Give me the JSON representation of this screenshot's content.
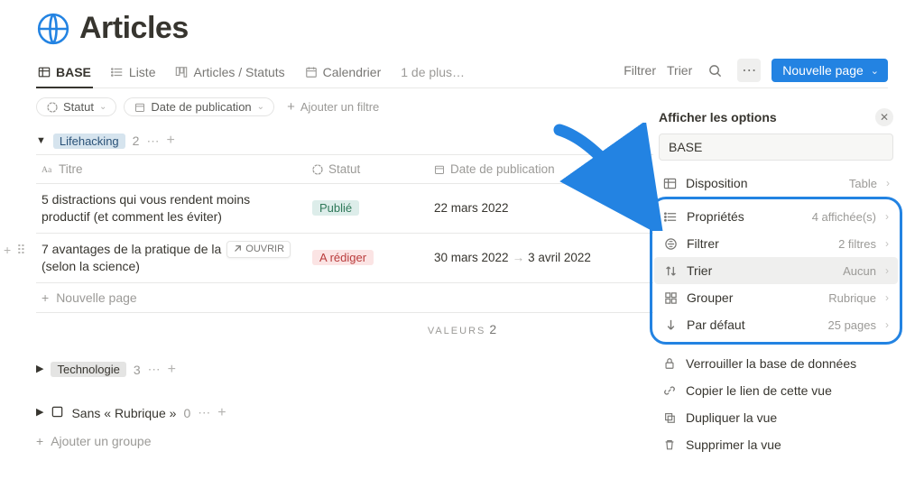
{
  "page": {
    "title": "Articles"
  },
  "tabs": {
    "items": [
      {
        "label": "BASE"
      },
      {
        "label": "Liste"
      },
      {
        "label": "Articles / Statuts"
      },
      {
        "label": "Calendrier"
      }
    ],
    "more_label": "1 de plus…"
  },
  "toolbar": {
    "filter_label": "Filtrer",
    "sort_label": "Trier",
    "new_page_label": "Nouvelle page"
  },
  "filters": {
    "pill_status": "Statut",
    "pill_date": "Date de publication",
    "add_filter_label": "Ajouter un filtre"
  },
  "columns": {
    "title": "Titre",
    "status": "Statut",
    "date": "Date de publication"
  },
  "groups": {
    "g0": {
      "label": "Lifehacking",
      "count": "2",
      "rows": [
        {
          "title": "5 distractions qui vous rendent moins productif (et comment les éviter)",
          "status": "Publié",
          "date": "22 mars 2022"
        },
        {
          "title": "7 avantages de la pratique de la",
          "title_suffix": "(selon la science)",
          "status": "A rédiger",
          "date_start": "30 mars 2022",
          "date_end": "3 avril 2022"
        }
      ],
      "open_label": "OUVRIR",
      "new_page_label": "Nouvelle page",
      "values_label": "VALEURS",
      "values_count": "2"
    },
    "g1": {
      "label": "Technologie",
      "count": "3"
    },
    "g2": {
      "label": "Sans « Rubrique »",
      "count": "0"
    },
    "add_group_label": "Ajouter un groupe"
  },
  "panel": {
    "title": "Afficher les options",
    "input_value": "BASE",
    "rows": {
      "layout": {
        "label": "Disposition",
        "value": "Table"
      },
      "props": {
        "label": "Propriétés",
        "value": "4 affichée(s)"
      },
      "filter": {
        "label": "Filtrer",
        "value": "2 filtres"
      },
      "sort": {
        "label": "Trier",
        "value": "Aucun"
      },
      "group": {
        "label": "Grouper",
        "value": "Rubrique"
      },
      "default": {
        "label": "Par défaut",
        "value": "25 pages"
      },
      "lock": {
        "label": "Verrouiller la base de données"
      },
      "copylink": {
        "label": "Copier le lien de cette vue"
      },
      "duplicate": {
        "label": "Dupliquer la vue"
      },
      "delete": {
        "label": "Supprimer la vue"
      }
    }
  }
}
